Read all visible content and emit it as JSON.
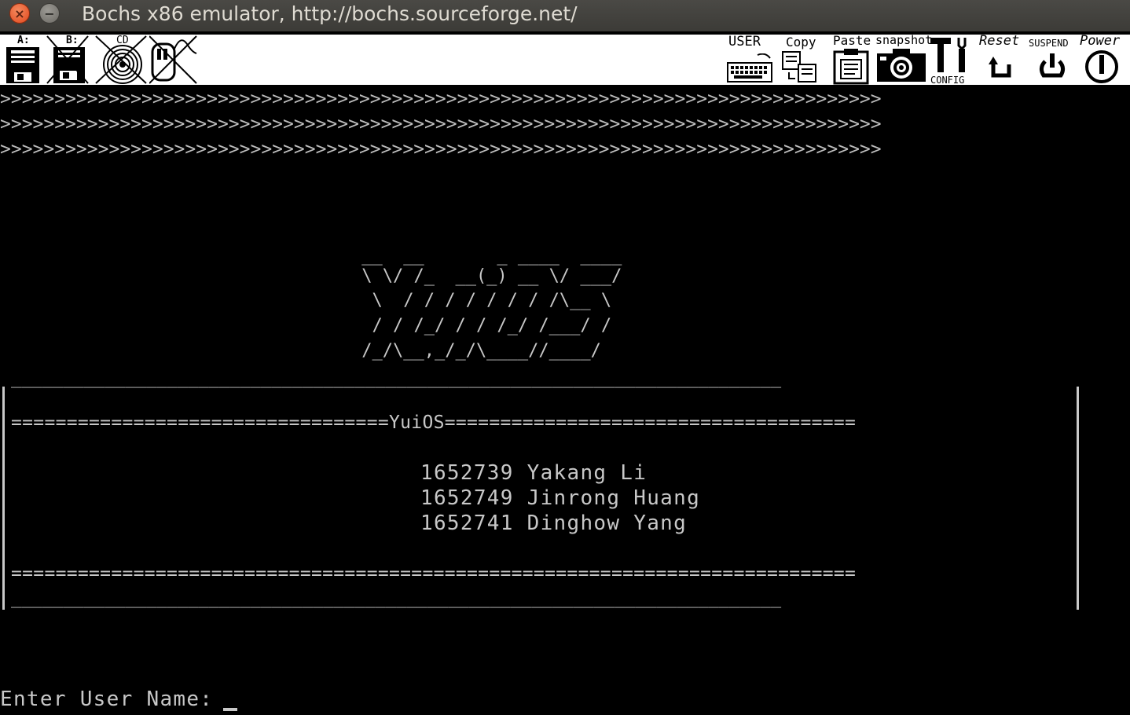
{
  "window": {
    "title": "Bochs x86 emulator, http://bochs.sourceforge.net/",
    "close_glyph": "×",
    "minimize_glyph": "−"
  },
  "toolbar": {
    "floppy_a_label": "A:",
    "floppy_b_label": "B:",
    "cdrom_label": "CD",
    "user_label": "USER",
    "copy_label": "Copy",
    "paste_label": "Paste",
    "snapshot_label": "snapshot",
    "config_label": "CONFIG",
    "reset_label": "Reset",
    "suspend_label": "SUSPEND",
    "power_label": "Power"
  },
  "console": {
    "arrow_rows": [
      ">>>>>>>>>>>>>>>>>>>>>>>>>>>>>>>>>>>>>>>>>>>>>>>>>>>>>>>>>>>>>>>>>>>>>>>>>>>>>>>>>",
      ">>>>>>>>>>>>>>>>>>>>>>>>>>>>>>>>>>>>>>>>>>>>>>>>>>>>>>>>>>>>>>>>>>>>>>>>>>>>>>>>>",
      ">>>>>>>>>>>>>>>>>>>>>>>>>>>>>>>>>>>>>>>>>>>>>>>>>>>>>>>>>>>>>>>>>>>>>>>>>>>>>>>>>"
    ],
    "logo_art": [
      " __  __       _ ____  ____ ",
      " \\ \\/ /_  __(_) __ \\/ ___/",
      "  \\  / / / / / / / /\\__ \\ ",
      "  / / /_/ / / /_/ /___/ / ",
      " /_/\\__,_/_/\\____//____/  "
    ],
    "frame_top": "__________________________________________________________________________",
    "banner_line": "==================================YuiOS=====================================",
    "members": [
      "1652739 Yakang Li",
      "1652749 Jinrong Huang",
      "1652741 Dinghow Yang"
    ],
    "frame_bottom_rule": "============================================================================",
    "frame_bottom": "__________________________________________________________________________",
    "prompt": "Enter User Name:"
  }
}
